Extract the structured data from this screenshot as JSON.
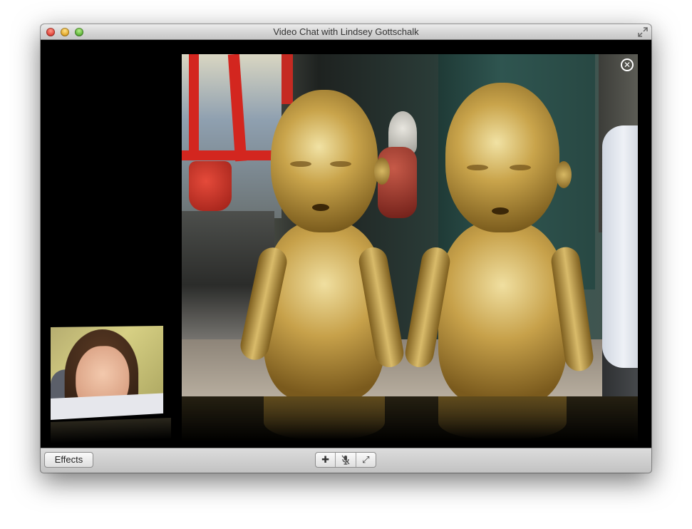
{
  "window": {
    "title": "Video Chat with Lindsey Gottschalk"
  },
  "titlebar": {
    "buttons": [
      "close",
      "minimize",
      "zoom"
    ],
    "fullscreen_icon": "fullscreen-icon"
  },
  "remote_video": {
    "close_icon": "close-circle-icon",
    "close_glyph": "✕"
  },
  "toolbar": {
    "effects_label": "Effects",
    "controls": [
      {
        "name": "add-participant",
        "icon": "plus-icon",
        "glyph": "✚"
      },
      {
        "name": "mute",
        "icon": "microphone-muted-icon",
        "glyph": "🎙"
      },
      {
        "name": "fullscreen",
        "icon": "fullscreen-icon",
        "glyph": "⤢"
      }
    ]
  }
}
